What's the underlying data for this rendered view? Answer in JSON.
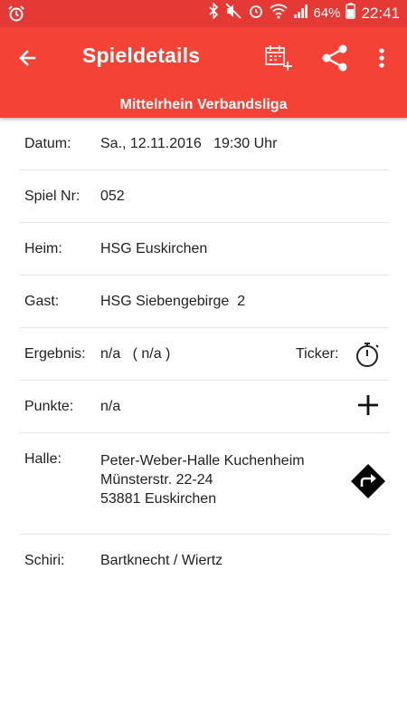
{
  "status_bar": {
    "battery": "64%",
    "time": "22:41"
  },
  "app_bar": {
    "title": "Spieldetails"
  },
  "league": "Mittelrhein Verbandsliga",
  "details": {
    "datum_label": "Datum:",
    "datum_value": "Sa., 12.11.2016   19:30 Uhr",
    "spielnr_label": "Spiel Nr:",
    "spielnr_value": "052",
    "heim_label": "Heim:",
    "heim_value": "HSG Euskirchen",
    "gast_label": "Gast:",
    "gast_value": "HSG Siebengebirge  2",
    "ergebnis_label": "Ergebnis:",
    "ergebnis_value": "n/a   ( n/a )",
    "ticker_label": "Ticker:",
    "punkte_label": "Punkte:",
    "punkte_value": "n/a",
    "halle_label": "Halle:",
    "halle_line1": "Peter-Weber-Halle Kuchenheim",
    "halle_line2": "Münsterstr. 22-24",
    "halle_line3": "53881 Euskirchen",
    "schiri_label": "Schiri:",
    "schiri_value": "Bartknecht / Wiertz"
  },
  "icons": {
    "status_left": "alarm-clock-icon",
    "back": "arrow-left-icon",
    "calendar_add": "calendar-add-icon",
    "share": "share-icon",
    "overflow": "more-vert-icon",
    "ticker": "stopwatch-icon",
    "punkte": "plus-icon",
    "directions": "directions-icon"
  },
  "colors": {
    "status_bar": "#e53935",
    "app_bar": "#f44336",
    "text": "#222222",
    "divider": "#e6e6e6"
  }
}
